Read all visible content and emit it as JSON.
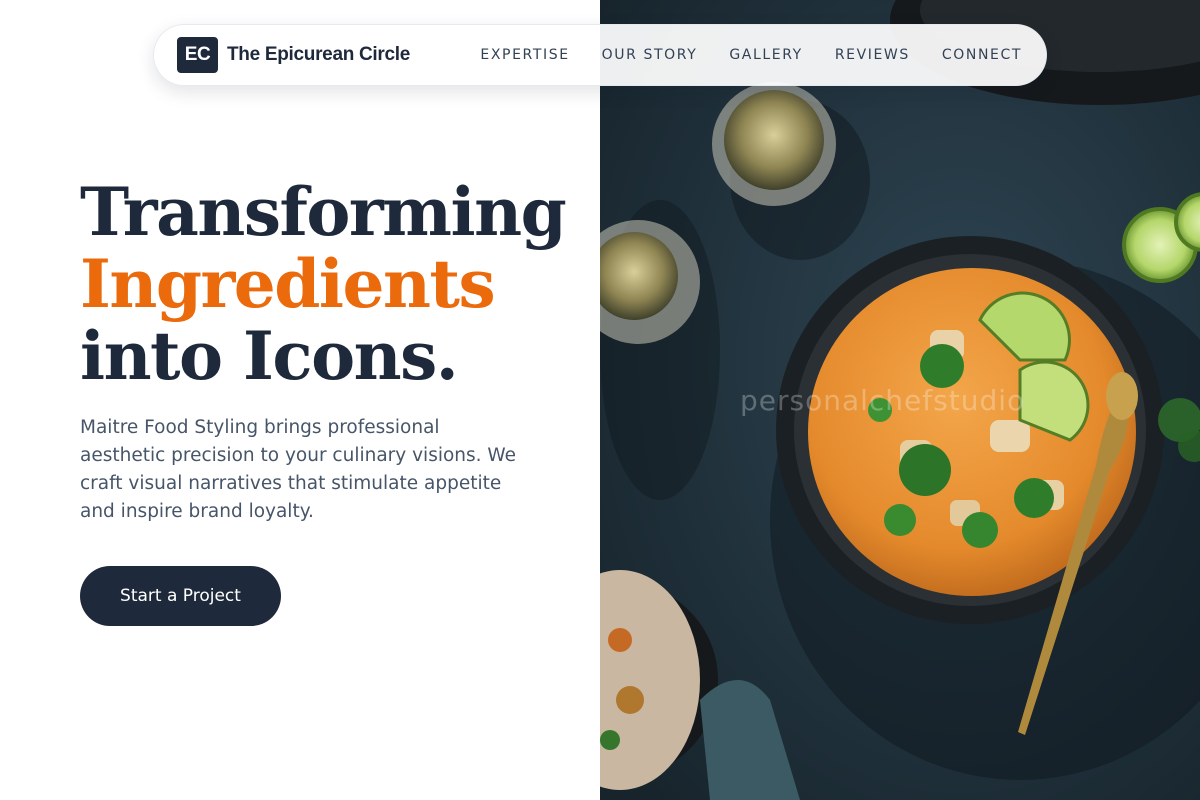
{
  "brand": {
    "logo_mark": "EC",
    "name": "The Epicurean Circle"
  },
  "nav": {
    "links": [
      "EXPERTISE",
      "OUR STORY",
      "GALLERY",
      "REVIEWS",
      "CONNECT"
    ]
  },
  "hero": {
    "headline_line1": "Transforming",
    "headline_accent": "Ingredients",
    "headline_line3": "into Icons.",
    "description": "Maitre Food Styling brings professional aesthetic precision to your culinary visions. We craft visual narratives that stimulate appetite and inspire brand loyalty.",
    "cta_label": "Start a Project",
    "photo_watermark": "personalchefstudio"
  },
  "colors": {
    "primary": "#1e293b",
    "accent": "#ea6a0c",
    "body_text": "#475569",
    "photo_background": "#233540"
  }
}
